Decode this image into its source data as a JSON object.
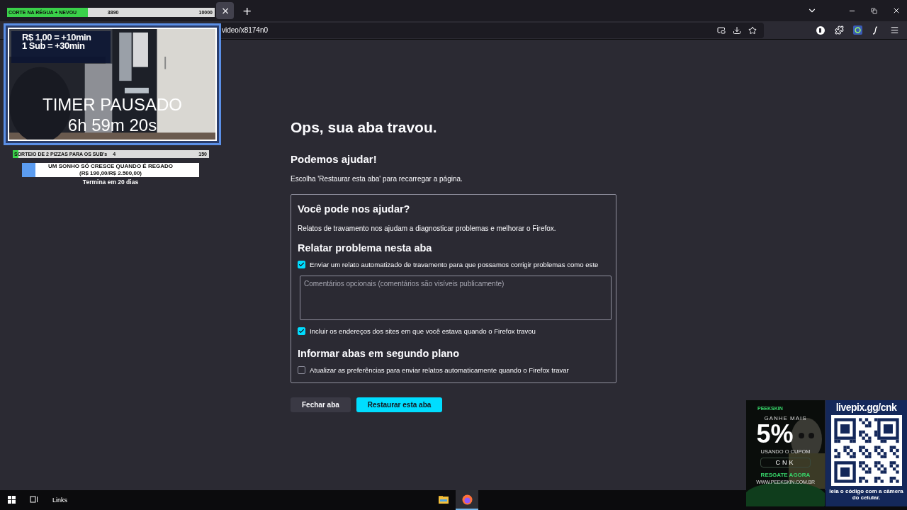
{
  "browser": {
    "tab_close": "×",
    "new_tab": "+",
    "url": "video/x8174n0"
  },
  "crash_page": {
    "title": "Ops, sua aba travou.",
    "help_heading": "Podemos ajudar!",
    "help_text": "Escolha 'Restaurar esta aba' para recarregar a página.",
    "box": {
      "title": "Você pode nos ajudar?",
      "description": "Relatos de travamento nos ajudam a diagnosticar problemas e melhorar o Firefox.",
      "sections": [
        {
          "heading": "Relatar problema nesta aba",
          "items": [
            {
              "kind": "checkbox",
              "label": "Enviar um relato automatizado de travamento para que possamos corrigir problemas como este",
              "checked": true
            },
            {
              "kind": "field",
              "placeholder": "Comentários opcionais (comentários são visíveis publicamente)"
            },
            {
              "kind": "checkbox",
              "label": "Incluir os endereços dos sites em que você estava quando o Firefox travou",
              "checked": true
            }
          ]
        },
        {
          "heading": "Informar abas em segundo plano",
          "items": [
            {
              "kind": "checkbox",
              "label": "Atualizar as preferências para enviar relatos automaticamente quando o Firefox travar",
              "checked": false
            }
          ]
        }
      ]
    },
    "buttons": [
      {
        "label": "Fechar aba",
        "kind": "secondary"
      },
      {
        "label": "Restaurar esta aba",
        "kind": "primary"
      }
    ]
  },
  "taskbar": {
    "links_label": "Links",
    "apps": [
      {
        "kind": "folder",
        "selected": false
      },
      {
        "kind": "firefox",
        "selected": true
      }
    ]
  },
  "stream_overlay": {
    "top_goal": {
      "label": "CORTE NA RÉGUA + NEVOU",
      "current": "3890",
      "target": "10000",
      "level": 0.389
    },
    "webcam": {
      "line_1": "R$ 1,00 = +10min",
      "line_2": "1 Sub = +30min",
      "timer_status": "TIMER PAUSADO",
      "timer_value": "6h 59m 20s"
    },
    "sub_goal": {
      "label": "SORTEIO DE 2 PIZZAS PARA OS SUB's",
      "current": "4",
      "target": "150",
      "level": 0.03
    },
    "donation_goal": {
      "title": "UM SONHO SÓ CRESCE QUANDO É REGADO",
      "amount": "(R$ 190,00/R$ 2.500,00)",
      "level": 0.076,
      "ends": "Termina em 20 dias"
    },
    "ad": {
      "brand": "PEEKSKIN",
      "headline": "GANHE MAIS",
      "percent": "5%",
      "coupon_hint": "USANDO O CUPOM",
      "coupon": "CNK",
      "cta": "RESGATE AGORA",
      "site": "WWW.PEEKSKIN.COM.BR"
    },
    "qr": {
      "link": "livepix.gg/cnk",
      "caption": "leia o código com a câmera do celular."
    }
  }
}
